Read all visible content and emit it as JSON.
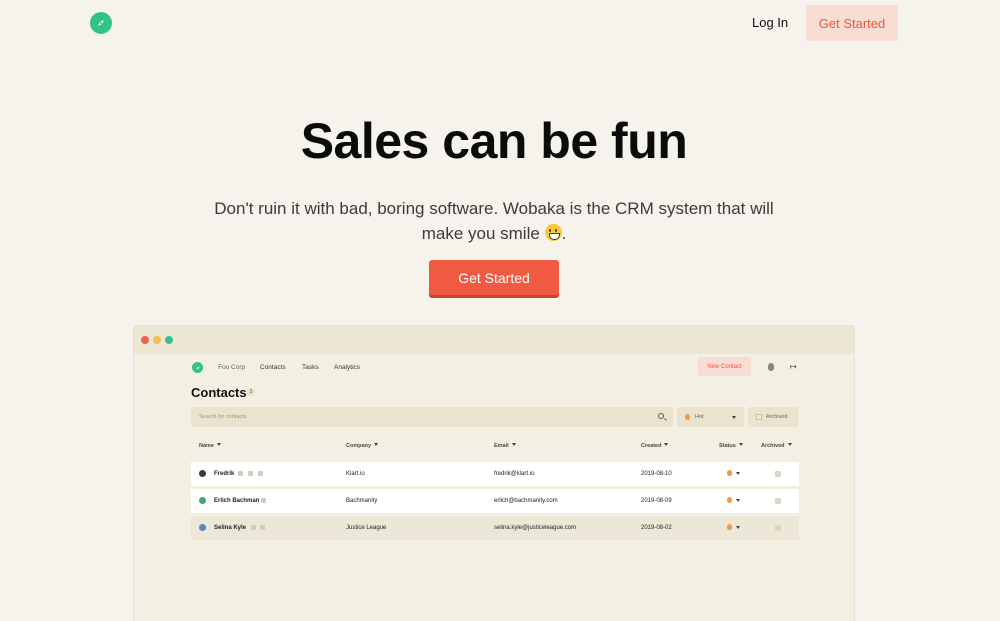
{
  "topnav": {
    "logo_icon": "compass-icon",
    "login_label": "Log In",
    "cta_label": "Get Started"
  },
  "hero": {
    "title": "Sales can be fun",
    "subtitle": "Don't ruin it with bad, boring software. Wobaka is the CRM system that will make you smile",
    "subtitle_end": ".",
    "emoji": "grinning-face-icon",
    "cta_label": "Get Started"
  },
  "colors": {
    "background": "#f6f3ec",
    "brand_green": "#33c28a",
    "accent": "#f05a42",
    "accent_soft": "#f8ddd5"
  },
  "app": {
    "nav": {
      "org": "Foo Corp",
      "contacts": "Contacts",
      "tasks": "Tasks",
      "analytics": "Analytics",
      "new_contact": "New Contact"
    },
    "page_title": "Contacts",
    "count": "3",
    "search_placeholder": "Search for contacts",
    "status_filter": "Hot",
    "archived_filter": "Archived",
    "columns": [
      "Name",
      "Company",
      "Email",
      "Created",
      "Status",
      "Archived"
    ],
    "rows": [
      {
        "name": "Fredrik",
        "company": "Klart.io",
        "email": "fredrik@klart.io",
        "created": "2019-08-10"
      },
      {
        "name": "Erlich Bachman",
        "company": "Bachmanity",
        "email": "erlich@bachmanity.com",
        "created": "2019-08-09"
      },
      {
        "name": "Selina Kyle",
        "company": "Justice League",
        "email": "selina.kyle@justiceleague.com",
        "created": "2019-08-02"
      }
    ]
  }
}
